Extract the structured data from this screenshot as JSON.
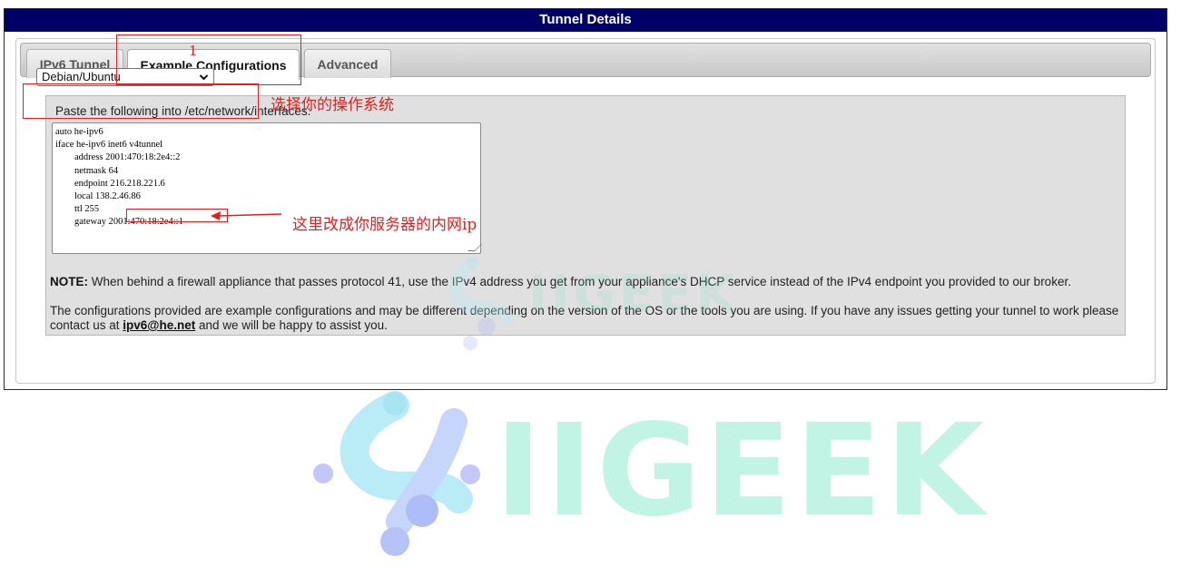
{
  "header": {
    "title": "Tunnel Details"
  },
  "tabs": [
    {
      "label": "IPv6 Tunnel",
      "active": false
    },
    {
      "label": "Example Configurations",
      "active": true
    },
    {
      "label": "Advanced",
      "active": false
    }
  ],
  "os_select": {
    "selected": "Debian/Ubuntu"
  },
  "config": {
    "paste_label": "Paste the following into /etc/network/interfaces:",
    "lines": [
      "auto he-ipv6",
      "iface he-ipv6 inet6 v4tunnel",
      "        address 2001:470:18:2e4::2",
      "        netmask 64",
      "        endpoint 216.218.221.6",
      "        local 138.2.46.86",
      "        ttl 255",
      "        gateway 2001:470:18:2e4::1"
    ]
  },
  "note": {
    "label": "NOTE:",
    "text": " When behind a firewall appliance that passes protocol 41, use the IPv4 address you get from your appliance's DHCP service instead of the IPv4 endpoint you provided to our broker."
  },
  "disclaimer": {
    "text_before": "The configurations provided are example configurations and may be different depending on the version of the OS or the tools you are using. If you have any issues getting your tunnel to work please contact us at ",
    "email": "ipv6@he.net",
    "text_after": " and we will be happy to assist you."
  },
  "annotations": {
    "step_number": "1",
    "select_os": "选择你的操作系统",
    "change_ip": "这里改成你服务器的内网ip",
    "color": "#e02020"
  },
  "watermark": {
    "text": "IIGEEK"
  },
  "colors": {
    "header_bg": "#000066",
    "header_text": "#ffffff",
    "config_bg": "#e0e0e0",
    "annotation": "#e02020"
  },
  "icons": {
    "select_chevron": "chevron-down-icon",
    "logo": "iigeek-logo-icon"
  }
}
